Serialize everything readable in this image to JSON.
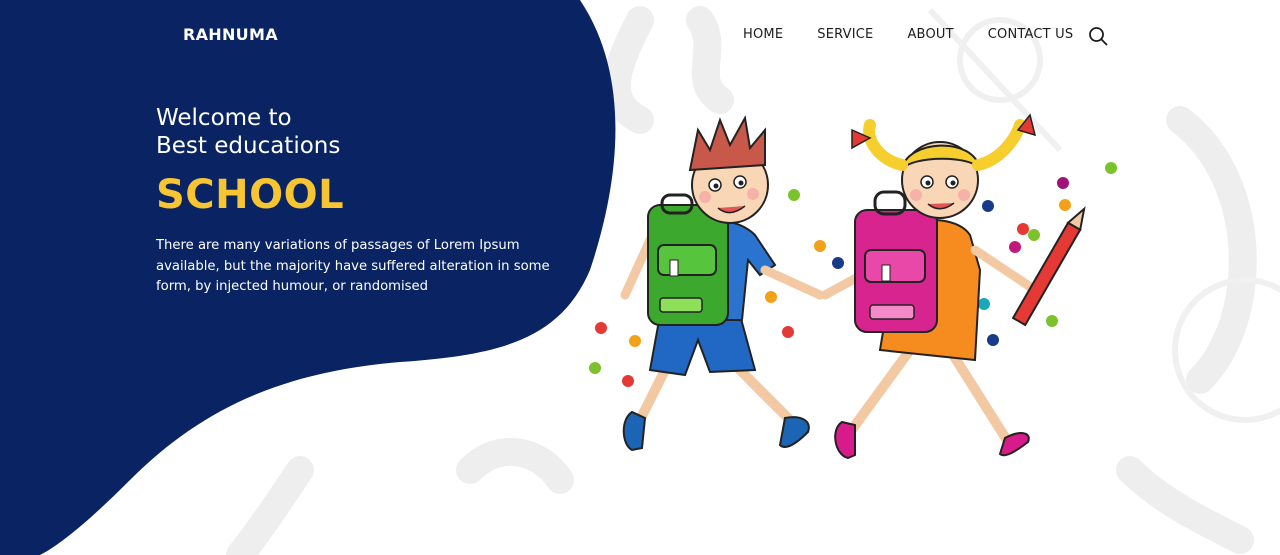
{
  "brand": {
    "name": "RAHNUMA"
  },
  "nav": {
    "items": [
      {
        "label": "HOME"
      },
      {
        "label": "SERVICE"
      },
      {
        "label": "ABOUT"
      },
      {
        "label": "CONTACT US"
      }
    ],
    "search_icon": "search-icon"
  },
  "hero": {
    "welcome_line1": "Welcome to",
    "welcome_line2": "Best educations",
    "highlight": "SCHOOL",
    "description": "There are many variations of passages of Lorem Ipsum available, but the majority have suffered alteration in some form, by injected humour, or randomised"
  },
  "colors": {
    "navy": "#0a2463",
    "accent_yellow": "#f7c531",
    "text_dark": "#1c1c1c"
  }
}
